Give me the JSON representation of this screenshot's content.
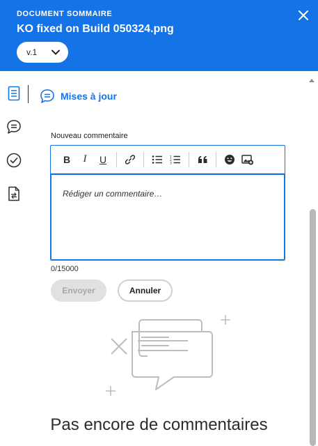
{
  "header": {
    "eyebrow": "DOCUMENT SOMMAIRE",
    "title": "KO fixed on Build 050324.png",
    "version": "v.1",
    "close_icon": "close-icon",
    "background": "#1473e6"
  },
  "rail": {
    "icons": [
      "document-icon",
      "comment-icon",
      "checkmark-circle-icon",
      "file-compare-icon"
    ]
  },
  "tab": {
    "label": "Mises à jour",
    "icon": "comment-icon",
    "color": "#1473e6"
  },
  "comment_form": {
    "label": "Nouveau commentaire",
    "toolbar": {
      "bold": "B",
      "italic": "I",
      "underline": "U",
      "icons": [
        "link-icon",
        "bullet-list-icon",
        "numbered-list-icon",
        "quote-icon",
        "emoji-icon",
        "image-icon"
      ]
    },
    "placeholder": "Rédiger un commentaire…",
    "counter": "0/15000",
    "send_label": "Envoyer",
    "cancel_label": "Annuler"
  },
  "empty_state": {
    "text": "Pas encore de commentaires",
    "icon": "empty-comments-illustration"
  }
}
